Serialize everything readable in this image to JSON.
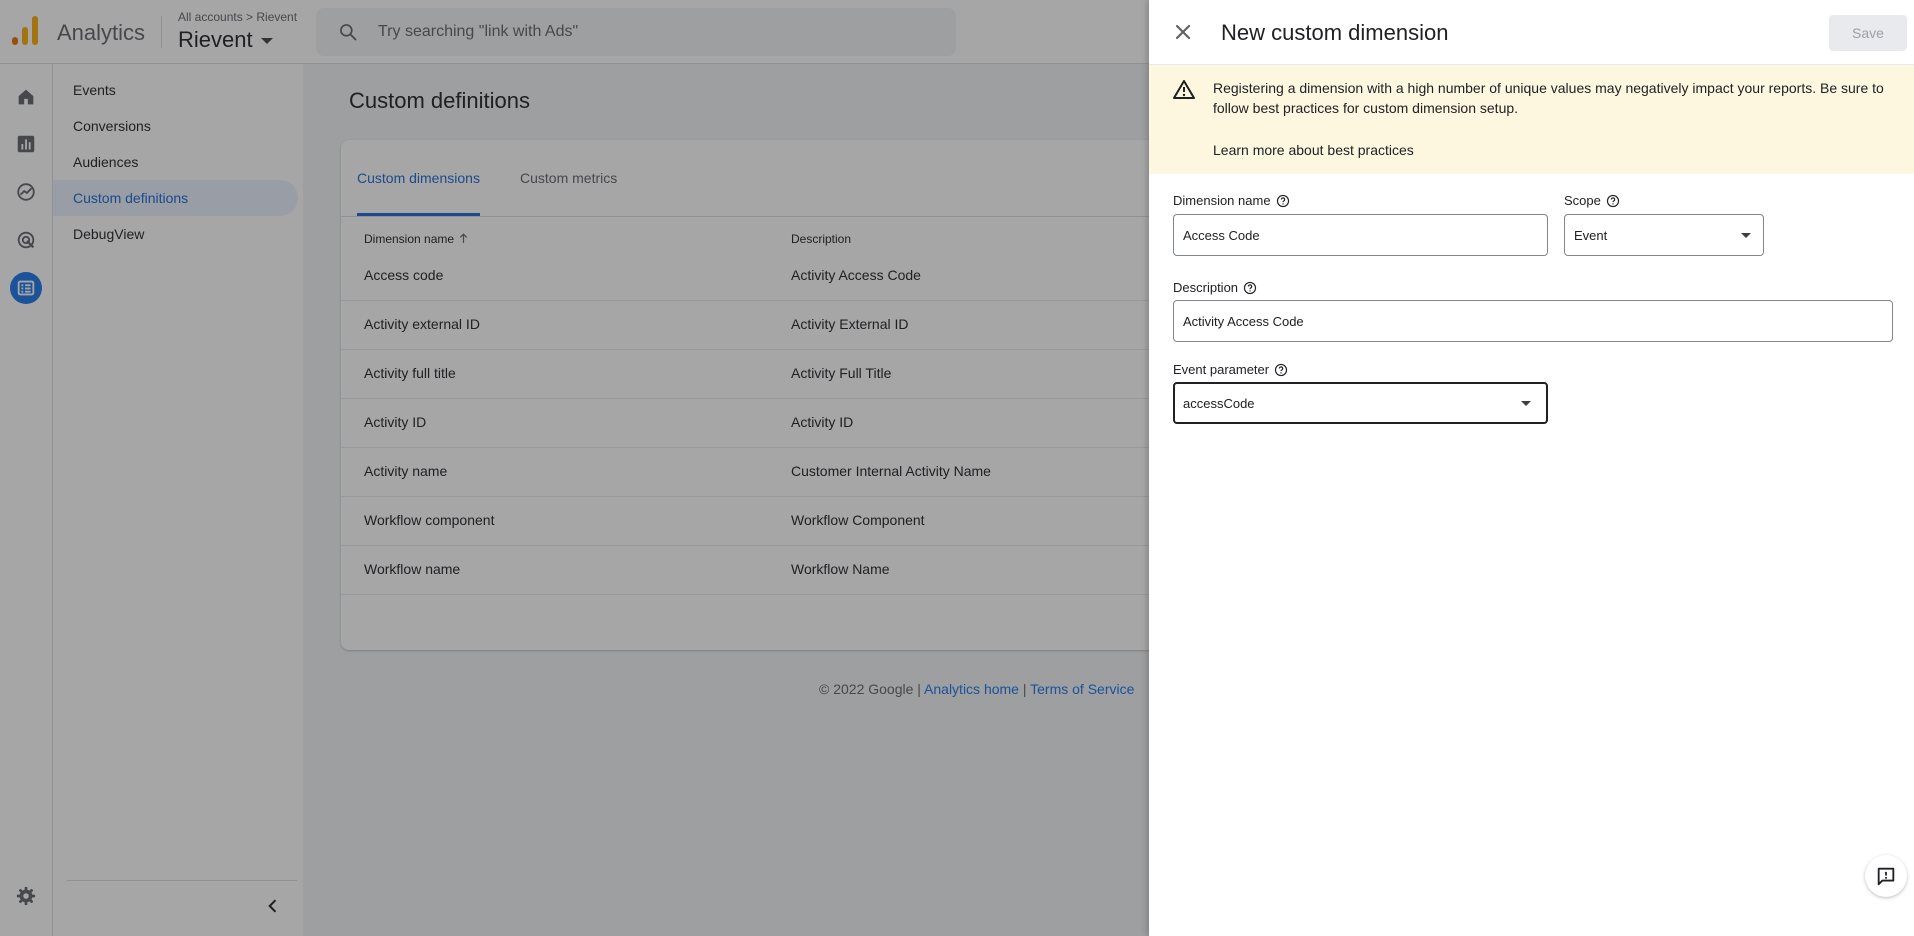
{
  "header": {
    "app_name": "Analytics",
    "breadcrumb": "All accounts > Rievent",
    "property": "Rievent",
    "search_placeholder": "Try searching \"link with Ads\""
  },
  "rail": {
    "icons": [
      "home-icon",
      "reports-icon",
      "explore-icon",
      "advertising-icon",
      "configure-icon",
      "settings-icon"
    ]
  },
  "nav": {
    "items": [
      {
        "label": "Events"
      },
      {
        "label": "Conversions"
      },
      {
        "label": "Audiences"
      },
      {
        "label": "Custom definitions"
      },
      {
        "label": "DebugView"
      }
    ]
  },
  "main": {
    "title": "Custom definitions",
    "tabs": [
      {
        "label": "Custom dimensions"
      },
      {
        "label": "Custom metrics"
      }
    ],
    "columns": [
      "Dimension name",
      "Description"
    ],
    "rows": [
      {
        "name": "Access code",
        "description": "Activity Access Code"
      },
      {
        "name": "Activity external ID",
        "description": "Activity External ID"
      },
      {
        "name": "Activity full title",
        "description": "Activity Full Title"
      },
      {
        "name": "Activity ID",
        "description": "Activity ID"
      },
      {
        "name": "Activity name",
        "description": "Customer Internal Activity Name"
      },
      {
        "name": "Workflow component",
        "description": "Workflow Component"
      },
      {
        "name": "Workflow name",
        "description": "Workflow Name"
      }
    ],
    "footer": {
      "copyright": "© 2022 Google | ",
      "home_link": "Analytics home",
      "sep": " | ",
      "terms_link": "Terms of Service"
    }
  },
  "drawer": {
    "title": "New custom dimension",
    "save_label": "Save",
    "warning": "Registering a dimension with a high number of unique values may negatively impact your reports. Be sure to follow best practices for custom dimension setup.",
    "warning_link": "Learn more about best practices",
    "fields": {
      "dimension_name": {
        "label": "Dimension name",
        "value": "Access Code"
      },
      "scope": {
        "label": "Scope",
        "value": "Event"
      },
      "description": {
        "label": "Description",
        "value": "Activity Access Code"
      },
      "event_parameter": {
        "label": "Event parameter",
        "value": "accessCode"
      }
    }
  },
  "colors": {
    "accent": "#1a73e8",
    "active_nav_bg": "#e8f0fe",
    "warning_bg": "#fef7e0",
    "logo_orange": "#f9ab00",
    "logo_dark": "#e37400"
  }
}
